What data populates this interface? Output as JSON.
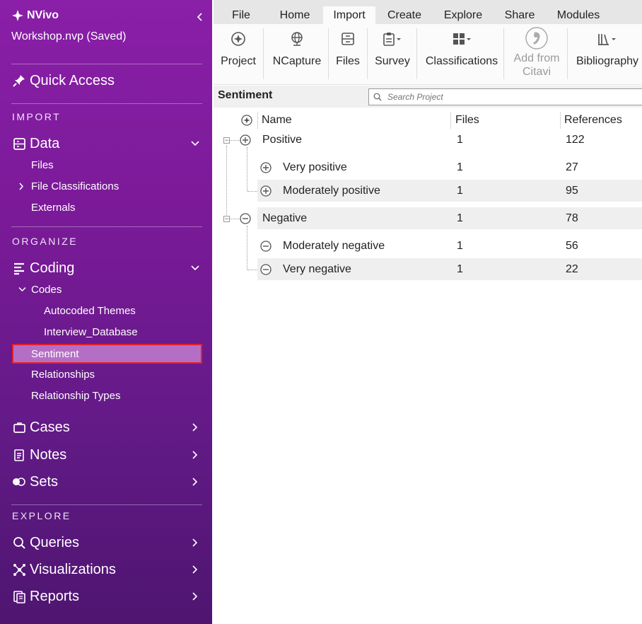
{
  "app": {
    "title": "NVivo",
    "project_name": "Workshop.nvp (Saved)"
  },
  "sidebar": {
    "quick_access": "Quick Access",
    "sections": {
      "import": "IMPORT",
      "organize": "ORGANIZE",
      "explore": "EXPLORE"
    },
    "data": {
      "label": "Data",
      "items": [
        "Files",
        "File Classifications",
        "Externals"
      ]
    },
    "coding": {
      "label": "Coding",
      "codes_label": "Codes",
      "code_children": [
        "Autocoded Themes",
        "Interview_Database"
      ],
      "selected": "Sentiment",
      "items": [
        "Relationships",
        "Relationship Types"
      ]
    },
    "cases": "Cases",
    "notes": "Notes",
    "sets": "Sets",
    "queries": "Queries",
    "visualizations": "Visualizations",
    "reports": "Reports"
  },
  "ribbon": {
    "tabs": [
      "File",
      "Home",
      "Import",
      "Create",
      "Explore",
      "Share",
      "Modules"
    ],
    "active_tab": "Import",
    "buttons": {
      "project": "Project",
      "ncapture": "NCapture",
      "files": "Files",
      "survey": "Survey",
      "classifications": "Classifications",
      "add_from": "Add from",
      "citavi": "Citavi",
      "bibliography": "Bibliography"
    }
  },
  "content": {
    "title": "Sentiment",
    "search_placeholder": "Search Project",
    "columns": {
      "name": "Name",
      "files": "Files",
      "references": "References"
    },
    "rows": [
      {
        "name": "Positive",
        "files": "1",
        "references": "122",
        "icon": "plus-circle-icon"
      },
      {
        "name": "Very positive",
        "files": "1",
        "references": "27",
        "icon": "plus-circle-icon"
      },
      {
        "name": "Moderately positive",
        "files": "1",
        "references": "95",
        "icon": "plus-circle-icon"
      },
      {
        "name": "Negative",
        "files": "1",
        "references": "78",
        "icon": "minus-circle-icon"
      },
      {
        "name": "Moderately negative",
        "files": "1",
        "references": "56",
        "icon": "minus-circle-icon"
      },
      {
        "name": "Very negative",
        "files": "1",
        "references": "22",
        "icon": "minus-circle-icon"
      }
    ]
  },
  "colors": {
    "sidebar_top": "#8a1fa8",
    "sidebar_bottom": "#4e1570",
    "selected_bg": "#b56ec6",
    "selected_border": "#e0202c"
  }
}
